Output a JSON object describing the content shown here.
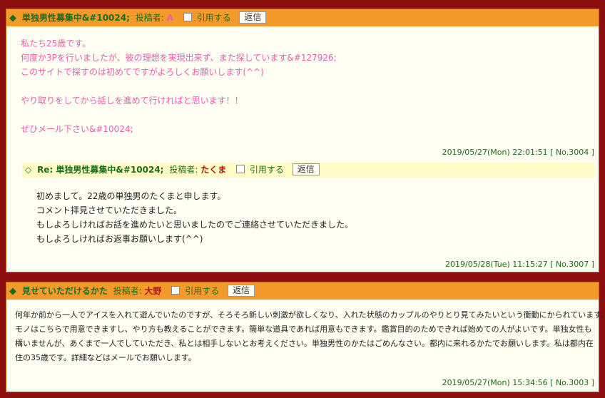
{
  "posts": [
    {
      "title": "単独男性募集中&#10024;",
      "poster_label": "投稿者:",
      "poster_name": "A",
      "quote_label": "引用する",
      "reply_label": "返信",
      "body_lines": [
        "私たち25歳です。",
        "何度か3Pを行いましたが、彼の理想を実現出来ず、また探しています&#127926;",
        "このサイトで探すのは初めてですがよろしくお願いします(^^)",
        "",
        "やり取りをしてから話しを進めて行ければと思います！！",
        "",
        "ぜひメール下さい&#10024;"
      ],
      "footer": "2019/05/27(Mon) 22:01:51 [ No.3004 ]",
      "reply": {
        "title": "Re: 単独男性募集中&#10024;",
        "poster_label": "投稿者:",
        "poster_name": "たくま",
        "quote_label": "引用する",
        "reply_label": "返信",
        "body_lines": [
          "初めまして。22歳の単独男のたくまと申します。",
          "コメント拝見させていただきました。",
          "もしよろしければお話を進めたいと思いましたのでご連絡させていただきました。",
          "もしよろしければお返事お願いします(^^)"
        ],
        "footer": "2019/05/28(Tue) 11:15:27 [ No.3007 ]"
      }
    },
    {
      "title": "見せていただけるかた",
      "poster_label": "投稿者:",
      "poster_name": "大野",
      "quote_label": "引用する",
      "reply_label": "返信",
      "body_lines": [
        "何年か前から一人でアイスを入れて遊んでいたのですが、そろそろ新しい刺激が欲しくなり、入れた状態のカップルのやりとり見てみたいという衝動にかられています。",
        "モノはこちらで用意できますし、やり方も教えることができます。簡単な道具であれば用意もできます。鑑賞目的のためできれば始めての人がよいです。単独女性も",
        "構いませんが、あくまで一人でしていただき、私とは相手しないとお考えください。単独男性のかたはごめんなさい。都内に来れるかたでお願いします。私は都内在",
        "住の35歳です。詳細などはメールでお願いします。"
      ],
      "footer": "2019/05/27(Mon) 15:34:56 [ No.3003 ]"
    }
  ],
  "colors": {
    "page_bg": "#8b0d0d",
    "header_bg": "#f39a2a",
    "post_bg": "#fffef2",
    "reply_header_bg": "#fffcc8",
    "title_green": "#1e6b1e",
    "pink_text": "#e65fb0",
    "poster_red": "#b01818"
  }
}
